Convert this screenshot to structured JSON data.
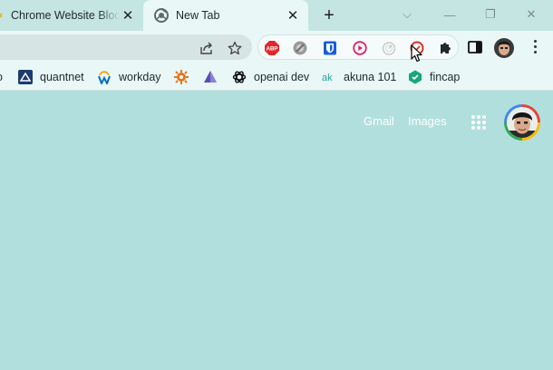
{
  "tabs": [
    {
      "title": "Chrome Website Blocker",
      "active": false,
      "close_label": "✕"
    },
    {
      "title": "New Tab",
      "active": true,
      "close_label": "✕"
    }
  ],
  "new_tab_label": "+",
  "window_controls": {
    "tab_search": "⌵",
    "minimize": "—",
    "restore": "❐",
    "close": "✕"
  },
  "toolbar": {
    "extensions": [
      {
        "name": "adblock-plus",
        "label": "ABP",
        "color": "#e4262b"
      },
      {
        "name": "grey-circle-extension",
        "color": "#9a9a9a"
      },
      {
        "name": "bitwarden",
        "color": "#175ddc"
      },
      {
        "name": "play-extension",
        "color": "#e0226a"
      },
      {
        "name": "timer-extension",
        "color": "#bdbdbd"
      },
      {
        "name": "website-blocker",
        "color": "#d93025"
      }
    ]
  },
  "bookmarks": [
    {
      "label": "quantnet",
      "icon": "quantnet-icon"
    },
    {
      "label": "workday",
      "icon": "workday-icon"
    },
    {
      "label": "",
      "icon": "sun-gear-icon"
    },
    {
      "label": "",
      "icon": "pyramid-icon"
    },
    {
      "label": "openai dev",
      "icon": "openai-icon"
    },
    {
      "label": "akuna 101",
      "icon": "akuna-icon"
    },
    {
      "label": "fincap",
      "icon": "fincap-icon"
    }
  ],
  "page": {
    "gmail_label": "Gmail",
    "images_label": "Images"
  },
  "colors": {
    "page_background": "#b1dfdd",
    "tabstrip": "#c5e5e3",
    "toolbar": "#e9f7f6"
  }
}
